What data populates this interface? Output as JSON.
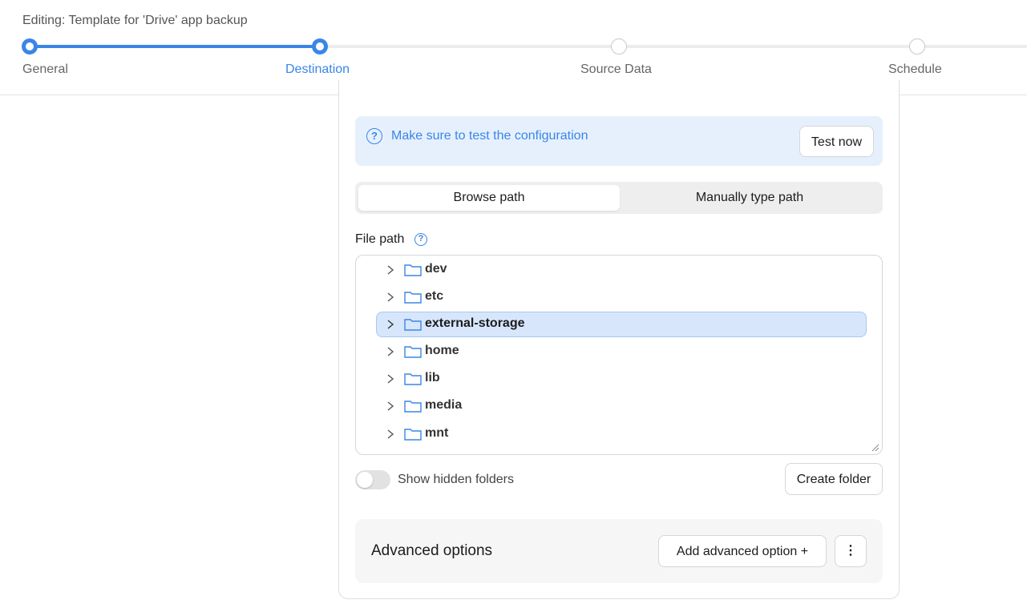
{
  "header": {
    "title": "Editing: Template for 'Drive' app backup"
  },
  "stepper": {
    "steps": [
      {
        "label": "General",
        "state": "done"
      },
      {
        "label": "Destination",
        "state": "active"
      },
      {
        "label": "Source Data",
        "state": "todo"
      },
      {
        "label": "Schedule",
        "state": "todo"
      }
    ]
  },
  "info": {
    "message": "Make sure to test the configuration",
    "icon": "question-circle-icon",
    "button": "Test now"
  },
  "path_mode": {
    "options": [
      "Browse path",
      "Manually type path"
    ],
    "selected": "Browse path"
  },
  "file_path": {
    "label": "File path",
    "folders": [
      "dev",
      "etc",
      "external-storage",
      "home",
      "lib",
      "media",
      "mnt"
    ],
    "selected": "external-storage"
  },
  "hidden_toggle": {
    "label": "Show hidden folders",
    "checked": false
  },
  "create_folder": {
    "label": "Create folder"
  },
  "advanced": {
    "title": "Advanced options",
    "add_label": "Add advanced option +",
    "more_label": "⋮"
  },
  "colors": {
    "accent": "#3a86e8",
    "info_bg": "#e6f0fd",
    "selected_row": "#d7e6fb"
  }
}
